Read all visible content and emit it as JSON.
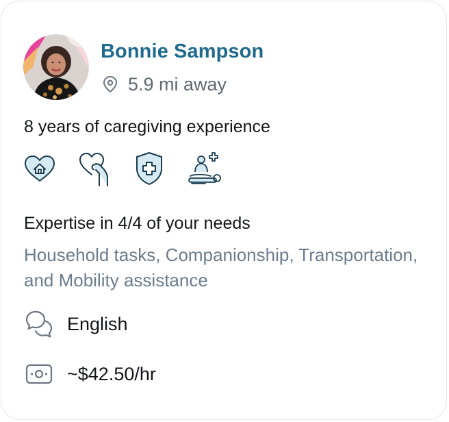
{
  "caregiver": {
    "name": "Bonnie Sampson",
    "distance": "5.9 mi away",
    "experience": "8 years of caregiving experience",
    "service_icons": [
      "home-heart-icon",
      "companionship-heart-hand-icon",
      "medical-shield-icon",
      "patient-care-icon"
    ],
    "expertise_title": "Expertise in 4/4 of your needs",
    "expertise_list": "Household tasks, Companionship, Transportation, and Mobility assistance",
    "language": "English",
    "rate": "~$42.50/hr"
  },
  "colors": {
    "name": "#1f6a8c",
    "icon_stroke": "#173a4c",
    "icon_fill": "#d6eaf4",
    "muted_text": "#6b7c8e"
  }
}
